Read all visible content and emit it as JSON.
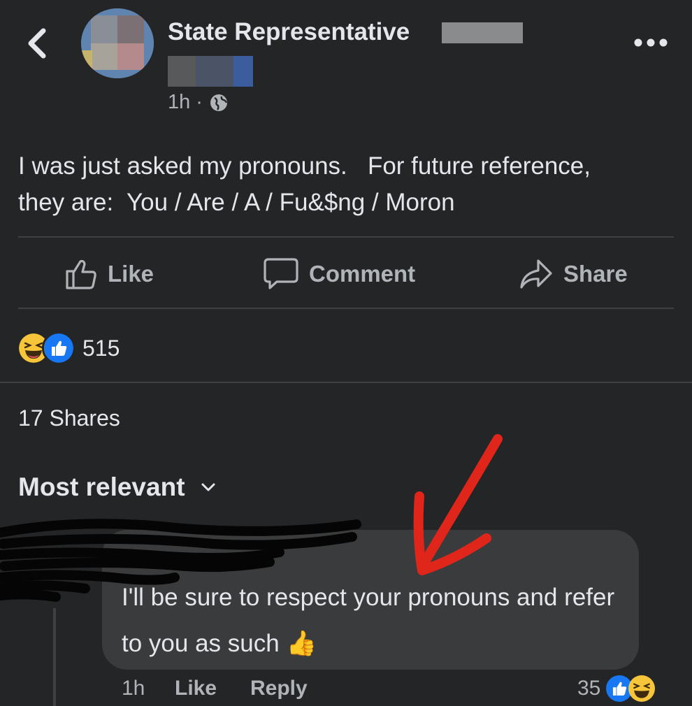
{
  "header": {
    "author_name": "State Representative",
    "time": "1h",
    "separator": "·",
    "audience_icon": "globe-icon",
    "back_icon": "chevron-left-icon",
    "more_icon": "more-dots-icon"
  },
  "post": {
    "text": "I was just asked my pronouns.   For future reference,\nthey are:  You / Are / A / Fu&$ng / Moron"
  },
  "actions": {
    "like_label": "Like",
    "comment_label": "Comment",
    "share_label": "Share"
  },
  "stats": {
    "reaction_icons": [
      "haha-icon",
      "like-icon"
    ],
    "reaction_count": "515",
    "shares": "17 Shares"
  },
  "comments_section": {
    "sort_label": "Most relevant",
    "sort_icon": "chevron-down-icon"
  },
  "comment": {
    "text": "I'll be sure to respect your pronouns and refer to you as such",
    "emoji": "👍",
    "time": "1h",
    "like_label": "Like",
    "reply_label": "Reply",
    "reaction_count": "35",
    "reaction_icons": [
      "like-icon",
      "haha-icon"
    ]
  },
  "colors": {
    "background": "#242526",
    "bubble": "#3a3b3c",
    "text_primary": "#e4e6eb",
    "text_secondary": "#b0b3b8",
    "like_blue": "#1877f2",
    "annotation_red": "#e0261b"
  }
}
